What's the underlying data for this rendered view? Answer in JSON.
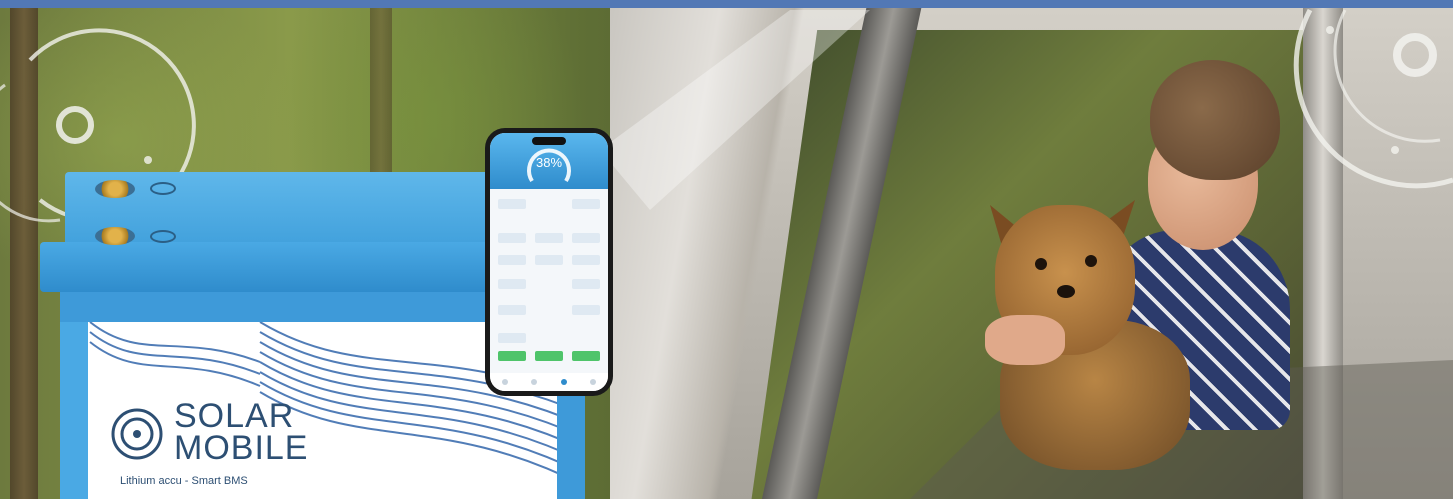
{
  "banner": {
    "accent_color": "#5278b5",
    "battery_color": "#4aa9e4",
    "brand_text_color": "#2d4f73"
  },
  "product": {
    "brand_line1": "SOLAR",
    "brand_line2": "MOBILE",
    "tagline": "Lithium accu - Smart BMS",
    "logo_icon": "circle-logo-icon"
  },
  "phone_app": {
    "soc_label": "38%"
  }
}
